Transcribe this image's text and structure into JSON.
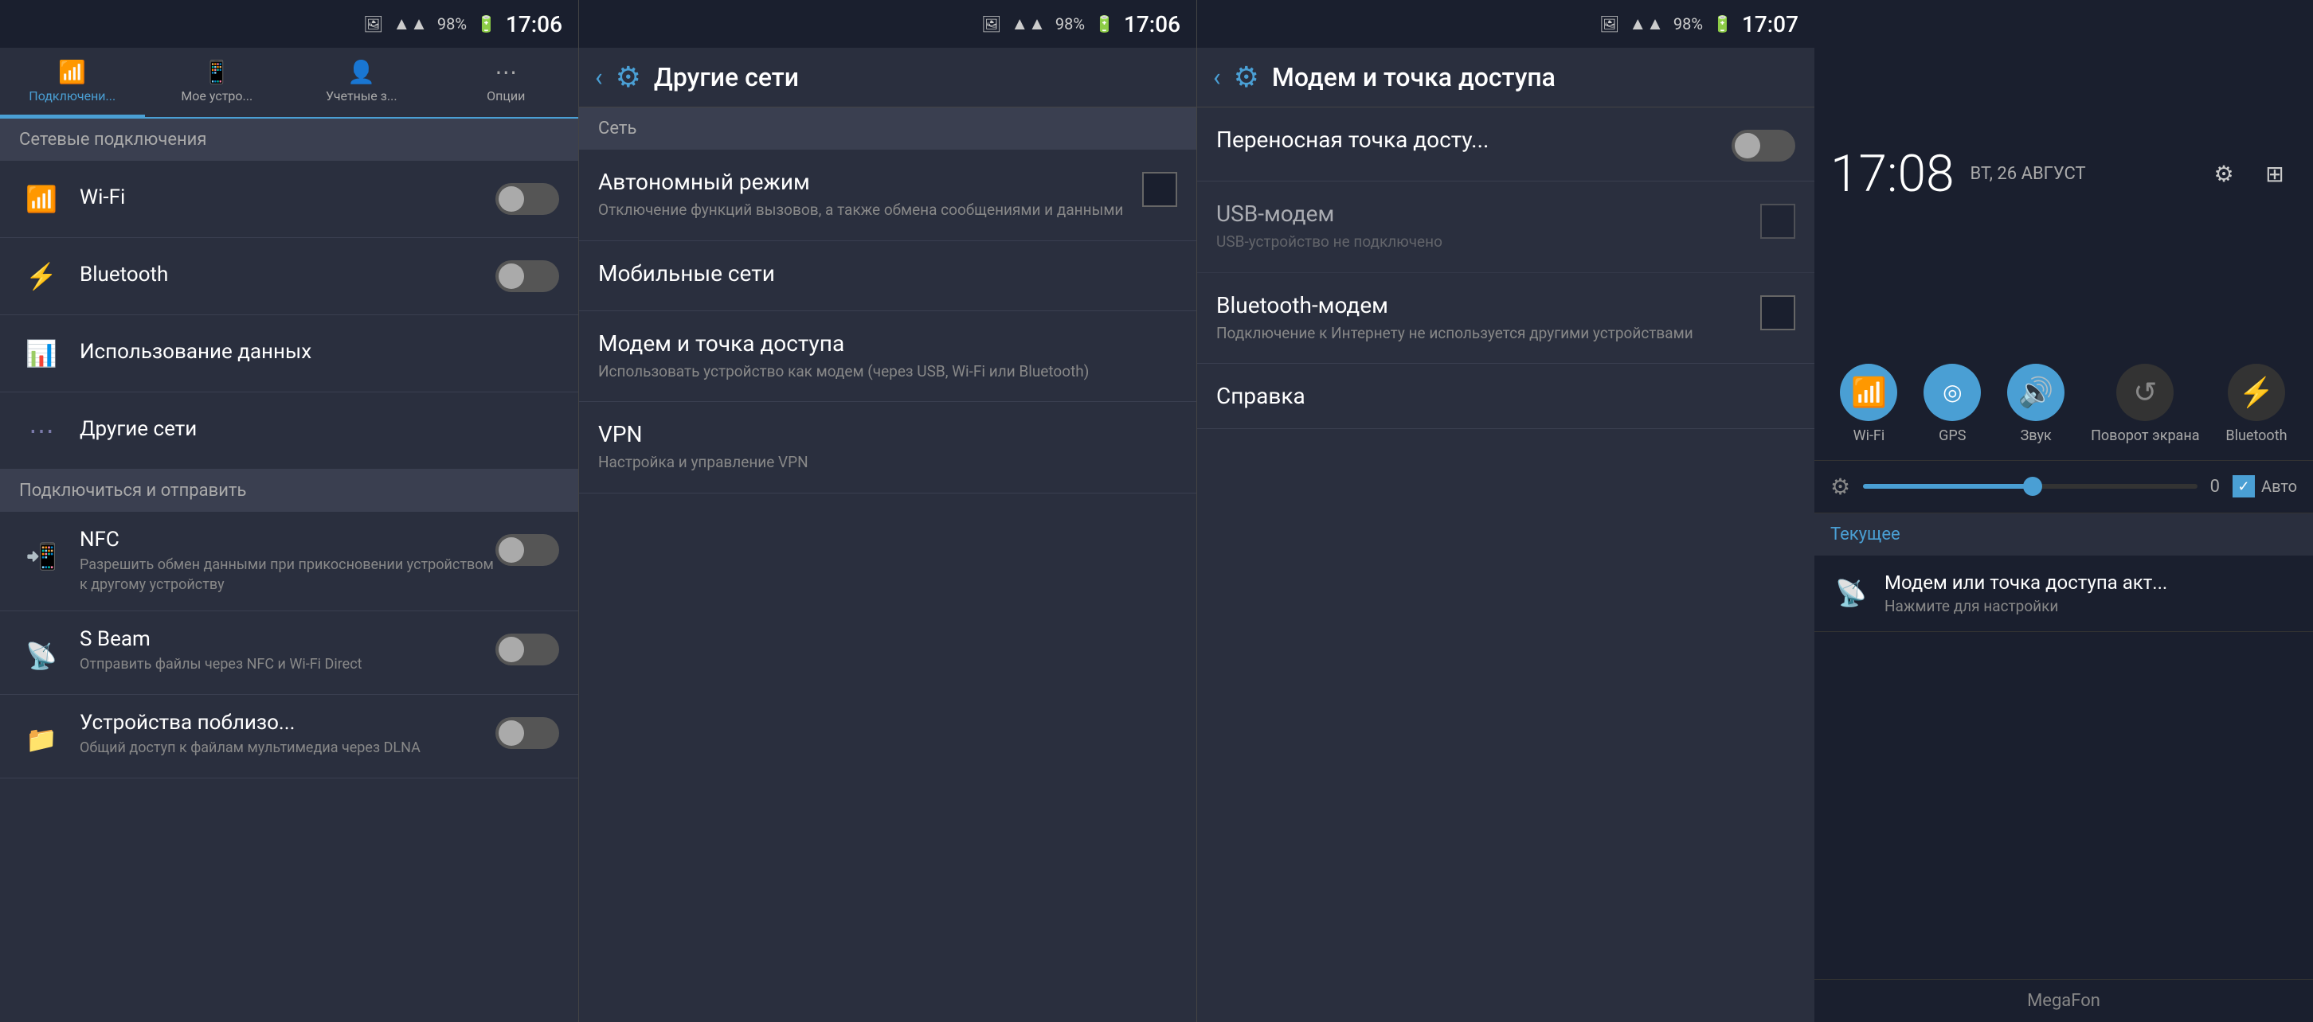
{
  "panel1": {
    "status": {
      "signal": "▲",
      "battery_pct": "98%",
      "battery_icon": "🔋",
      "time": "17:06",
      "img_icon": "🖼"
    },
    "tabs": [
      {
        "id": "connections",
        "label": "Подключени...",
        "icon": "📶",
        "active": true
      },
      {
        "id": "mydevice",
        "label": "Мое устро...",
        "icon": "📱",
        "active": false
      },
      {
        "id": "accounts",
        "label": "Учетные з...",
        "icon": "👤",
        "active": false
      },
      {
        "id": "options",
        "label": "Опции",
        "icon": "⋯",
        "active": false
      }
    ],
    "section_network": "Сетевые подключения",
    "items_network": [
      {
        "id": "wifi",
        "icon": "wifi",
        "title": "Wi-Fi",
        "toggle": false
      },
      {
        "id": "bluetooth",
        "icon": "bluetooth",
        "title": "Bluetooth",
        "toggle": false
      },
      {
        "id": "data_usage",
        "icon": "data",
        "title": "Использование данных",
        "toggle": null
      },
      {
        "id": "other_networks",
        "icon": "other",
        "title": "Другие сети",
        "toggle": null
      }
    ],
    "section_connect": "Подключиться и отправить",
    "items_connect": [
      {
        "id": "nfc",
        "icon": "nfc",
        "title": "NFC",
        "subtitle": "Разрешить обмен данными при прикосновении устройством к другому устройству",
        "toggle": false
      },
      {
        "id": "sbeam",
        "icon": "sbeam",
        "title": "S Beam",
        "subtitle": "Отправить файлы через NFC и Wi-Fi Direct",
        "toggle": false
      },
      {
        "id": "nearby",
        "icon": "nearby",
        "title": "Устройства поблизо...",
        "subtitle": "Общий доступ к файлам мультимедиа через DLNA",
        "toggle": false
      }
    ]
  },
  "panel2": {
    "status": {
      "battery_pct": "98%",
      "time": "17:06",
      "img_icon": "🖼"
    },
    "header": {
      "back": "‹",
      "gear": "⚙",
      "title": "Другие сети"
    },
    "section_net": "Сеть",
    "items": [
      {
        "id": "airplane",
        "title": "Автономный режим",
        "subtitle": "Отключение функций вызовов, а также обмена сообщениями и данными",
        "has_checkbox": true
      },
      {
        "id": "mobile",
        "title": "Мобильные сети",
        "subtitle": "",
        "has_checkbox": false
      },
      {
        "id": "modem",
        "title": "Модем и точка доступа",
        "subtitle": "Использовать устройство как модем (через USB, Wi-Fi или Bluetooth)",
        "has_checkbox": false
      },
      {
        "id": "vpn",
        "title": "VPN",
        "subtitle": "Настройка и управление VPN",
        "has_checkbox": false
      }
    ]
  },
  "panel3": {
    "status": {
      "battery_pct": "98%",
      "time": "17:07",
      "img_icon": "🖼"
    },
    "header": {
      "back": "‹",
      "gear": "⚙",
      "title": "Модем и точка доступа"
    },
    "items": [
      {
        "id": "portable_hotspot",
        "title": "Переносная точка досту...",
        "subtitle": "",
        "type": "toggle",
        "toggle_on": false
      },
      {
        "id": "usb_modem",
        "title": "USB-модем",
        "subtitle": "USB-устройство не подключено",
        "type": "checkbox",
        "disabled": true
      },
      {
        "id": "bt_modem",
        "title": "Bluetooth-модем",
        "subtitle": "Подключение к Интернету не используется другими устройствами",
        "type": "checkbox",
        "disabled": false
      }
    ],
    "справка": "Справка"
  },
  "panel4": {
    "time": "17:08",
    "date": "ВТ, 26 АВГУСТ",
    "header_icons": [
      {
        "id": "settings",
        "icon": "⚙"
      },
      {
        "id": "grid",
        "icon": "⊞"
      }
    ],
    "quick_toggles": [
      {
        "id": "wifi",
        "label": "Wi-Fi",
        "icon": "📶",
        "active": true
      },
      {
        "id": "gps",
        "label": "GPS",
        "icon": "◎",
        "active": true
      },
      {
        "id": "sound",
        "label": "Звук",
        "icon": "🔊",
        "active": true
      },
      {
        "id": "rotate",
        "label": "Поворот экрана",
        "icon": "↺",
        "active": false
      },
      {
        "id": "bluetooth",
        "label": "Bluetooth",
        "icon": "⚡",
        "active": false
      }
    ],
    "brightness": {
      "value": "0",
      "auto_label": "Авто",
      "auto_checked": true
    },
    "current_label": "Текущее",
    "notification": {
      "icon": "📡",
      "title": "Модем или точка доступа акт...",
      "subtitle": "Нажмите для настройки"
    },
    "carrier": "MegaFon"
  }
}
